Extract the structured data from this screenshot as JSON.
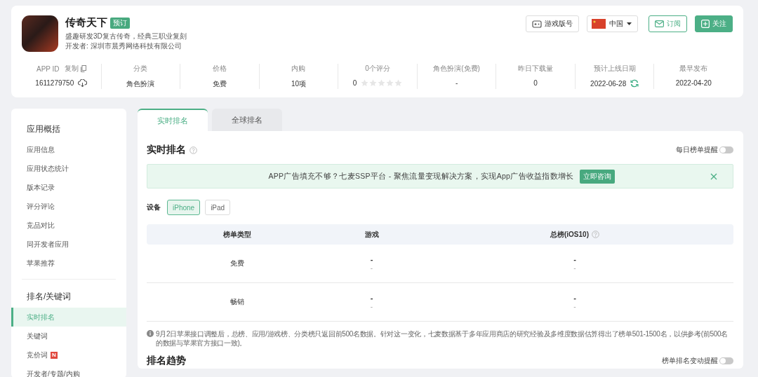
{
  "app": {
    "name": "传奇天下",
    "badge": "预订",
    "description": "盛趣研发3D复古传奇，经典三职业复刻",
    "developer": "开发者: 深圳市晨秀网络科技有限公司"
  },
  "header_actions": {
    "version_button": "游戏版号",
    "country": "中国",
    "subscribe": "订阅",
    "follow": "关注"
  },
  "stats": [
    {
      "kind": "appid",
      "label": "APP ID",
      "link": "复制",
      "value": "1611279750"
    },
    {
      "kind": "plain",
      "label": "分类",
      "value": "角色扮演"
    },
    {
      "kind": "plain",
      "label": "价格",
      "value": "免费"
    },
    {
      "kind": "plain",
      "label": "内购",
      "value": "10项"
    },
    {
      "kind": "rating",
      "label": "0个评分",
      "value": "0",
      "stars": 0
    },
    {
      "kind": "plain",
      "label": "角色扮演(免费)",
      "value": "-"
    },
    {
      "kind": "plain",
      "label": "昨日下载量",
      "value": "0"
    },
    {
      "kind": "date",
      "label": "预计上线日期",
      "value": "2022-06-28"
    },
    {
      "kind": "plain",
      "label": "最早发布",
      "value": "2022-04-20"
    }
  ],
  "sidebar": [
    {
      "title": "应用概括",
      "items": [
        {
          "label": "应用信息",
          "selected": false
        },
        {
          "label": "应用状态统计",
          "selected": false
        },
        {
          "label": "版本记录",
          "selected": false
        },
        {
          "label": "评分评论",
          "selected": false
        },
        {
          "label": "竞品对比",
          "selected": false
        },
        {
          "label": "同开发者应用",
          "selected": false
        },
        {
          "label": "苹果推荐",
          "selected": false
        }
      ]
    },
    {
      "title": "排名/关键词",
      "items": [
        {
          "label": "实时排名",
          "selected": true
        },
        {
          "label": "关键词",
          "selected": false
        },
        {
          "label": "竞价词",
          "selected": false,
          "badge": "N"
        },
        {
          "label": "开发者/专题/内购",
          "selected": false
        }
      ]
    }
  ],
  "tabs": [
    {
      "label": "实时排名",
      "selected": true
    },
    {
      "label": "全球排名",
      "selected": false
    }
  ],
  "section": {
    "title": "实时排名",
    "toggle": {
      "label": "每日榜单提醒",
      "on": false
    }
  },
  "ad_banner": {
    "text": "APP广告填充不够？七麦SSP平台 - 聚焦流量变现解决方案，实现App广告收益指数增长",
    "button": "立即咨询"
  },
  "device": {
    "label": "设备",
    "options": [
      {
        "label": "iPhone",
        "selected": true
      },
      {
        "label": "iPad",
        "selected": false
      }
    ]
  },
  "table": {
    "columns": [
      {
        "label": "榜单类型",
        "help": false
      },
      {
        "label": "游戏",
        "help": false
      },
      {
        "label": "总榜(iOS10)",
        "help": true
      }
    ],
    "rows": [
      {
        "cells": [
          {
            "value": "免费"
          },
          {
            "value": "-",
            "sub": "-"
          },
          {
            "value": "-",
            "sub": "-"
          }
        ]
      },
      {
        "cells": [
          {
            "value": "畅销"
          },
          {
            "value": "-",
            "sub": "-"
          },
          {
            "value": "-",
            "sub": "-"
          }
        ]
      }
    ]
  },
  "note": "9月2日苹果接口调整后，总榜、应用/游戏榜、分类榜只返回前500名数据。针对这一变化，七麦数据基于多年应用商店的研究经验及多维度数据估算得出了榜单501-1500名，以供参考(前500名的数据与苹果官方接口一致)。",
  "next_section": {
    "title": "排名趋势",
    "toggle": {
      "label": "榜单排名变动提醒",
      "on": false
    }
  }
}
